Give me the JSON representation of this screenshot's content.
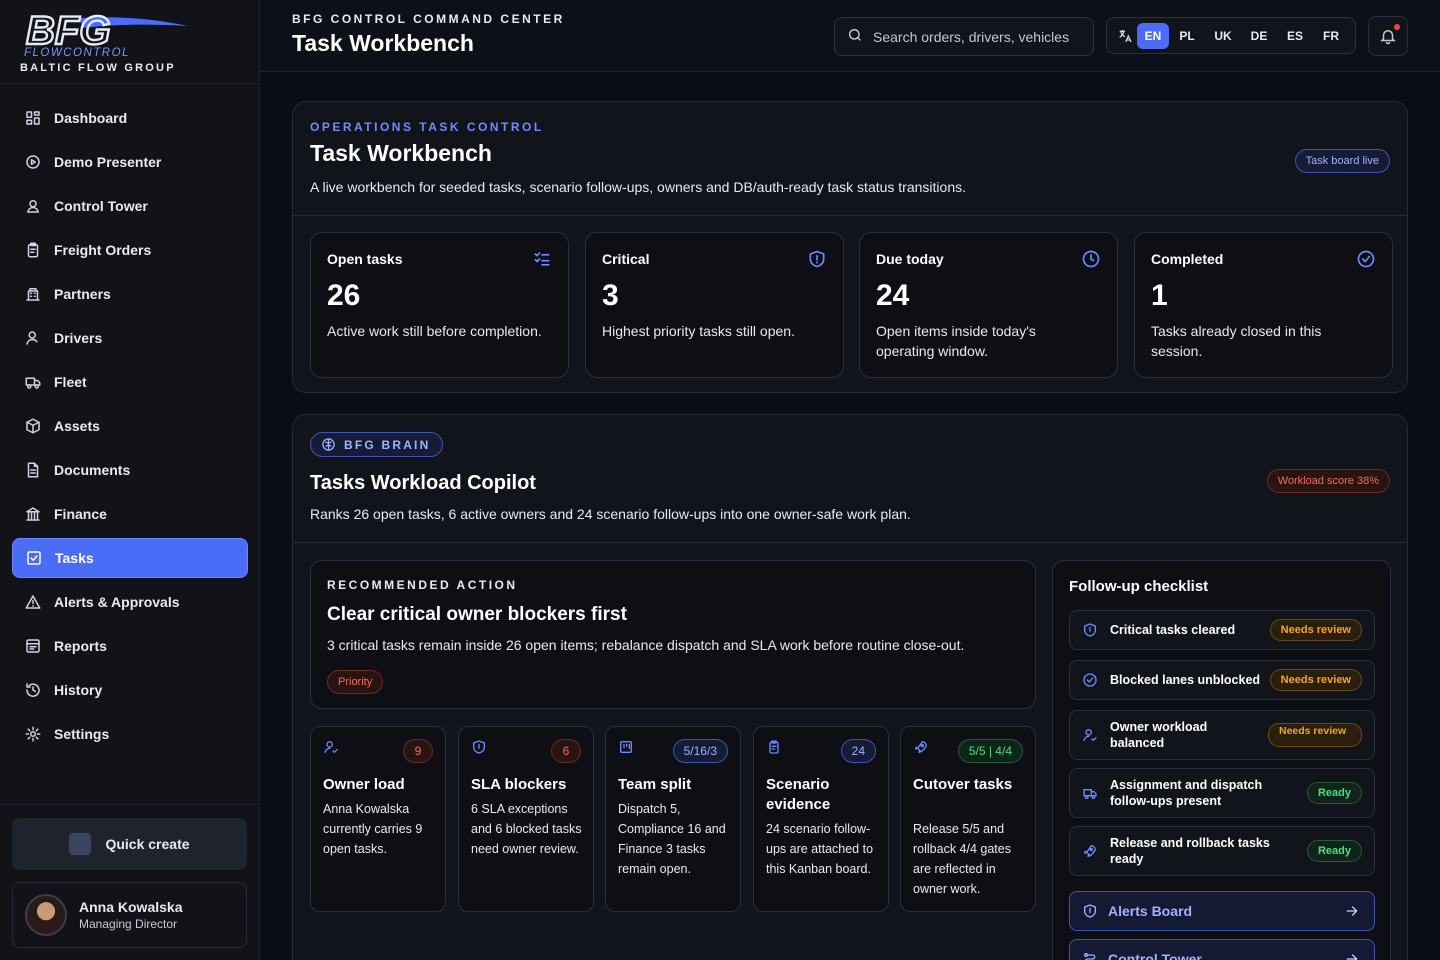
{
  "brand": {
    "logo_text": "BFG",
    "logo_sub": "FLOWCONTROL",
    "subtitle": "BALTIC FLOW GROUP"
  },
  "nav": [
    {
      "label": "Dashboard",
      "icon": "dashboard-icon"
    },
    {
      "label": "Demo Presenter",
      "icon": "play-icon"
    },
    {
      "label": "Control Tower",
      "icon": "control-tower-icon"
    },
    {
      "label": "Freight Orders",
      "icon": "clipboard-icon"
    },
    {
      "label": "Partners",
      "icon": "building-icon"
    },
    {
      "label": "Drivers",
      "icon": "user-icon"
    },
    {
      "label": "Fleet",
      "icon": "truck-icon"
    },
    {
      "label": "Assets",
      "icon": "package-icon"
    },
    {
      "label": "Documents",
      "icon": "document-icon"
    },
    {
      "label": "Finance",
      "icon": "bank-icon"
    },
    {
      "label": "Tasks",
      "icon": "checkbox-icon",
      "active": true
    },
    {
      "label": "Alerts & Approvals",
      "icon": "alert-triangle-icon"
    },
    {
      "label": "Reports",
      "icon": "report-icon"
    },
    {
      "label": "History",
      "icon": "history-icon"
    },
    {
      "label": "Settings",
      "icon": "gear-icon"
    }
  ],
  "quick_create": "Quick create",
  "user": {
    "name": "Anna Kowalska",
    "role": "Managing Director"
  },
  "header": {
    "kicker": "BFG CONTROL COMMAND CENTER",
    "title": "Task Workbench",
    "search_placeholder": "Search orders, drivers, vehicles",
    "languages": [
      "EN",
      "PL",
      "UK",
      "DE",
      "ES",
      "FR"
    ],
    "active_language": "EN"
  },
  "workbench": {
    "kicker": "OPERATIONS TASK CONTROL",
    "title": "Task Workbench",
    "description": "A live workbench for seeded tasks, scenario follow-ups, owners and DB/auth-ready task status transitions.",
    "status_pill": "Task board live",
    "stats": [
      {
        "label": "Open tasks",
        "value": "26",
        "desc": "Active work still before completion.",
        "icon": "list-check-icon"
      },
      {
        "label": "Critical",
        "value": "3",
        "desc": "Highest priority tasks still open.",
        "icon": "shield-alert-icon"
      },
      {
        "label": "Due today",
        "value": "24",
        "desc": "Open items inside today's operating window.",
        "icon": "clock-icon"
      },
      {
        "label": "Completed",
        "value": "1",
        "desc": "Tasks already closed in this session.",
        "icon": "check-circle-icon"
      }
    ]
  },
  "copilot": {
    "chip": "BFG BRAIN",
    "title": "Tasks Workload Copilot",
    "description": "Ranks 26 open tasks, 6 active owners and 24 scenario follow-ups into one owner-safe work plan.",
    "score_pill": "Workload score 38%",
    "recommended": {
      "kicker": "RECOMMENDED ACTION",
      "title": "Clear critical owner blockers first",
      "description": "3 critical tasks remain inside 26 open items; rebalance dispatch and SLA work before routine close-out.",
      "pill": "Priority"
    },
    "cards": [
      {
        "title": "Owner load",
        "badge": "9",
        "badge_tone": "red",
        "desc": "Anna Kowalska currently carries 9 open tasks.",
        "icon": "user-check-icon"
      },
      {
        "title": "SLA blockers",
        "badge": "6",
        "badge_tone": "red",
        "desc": "6 SLA exceptions and 6 blocked tasks need owner review.",
        "icon": "shield-icon"
      },
      {
        "title": "Team split",
        "badge": "5/16/3",
        "badge_tone": "blue",
        "desc": "Dispatch 5, Compliance 16 and Finance 3 tasks remain open.",
        "icon": "columns-icon"
      },
      {
        "title": "Scenario evidence",
        "badge": "24",
        "badge_tone": "blue",
        "desc": "24 scenario follow-ups are attached to this Kanban board.",
        "icon": "clipboard-icon"
      },
      {
        "title": "Cutover tasks",
        "badge": "5/5 | 4/4",
        "badge_tone": "green",
        "desc": "Release 5/5 and rollback 4/4 gates are reflected in owner work.",
        "icon": "rocket-icon"
      }
    ],
    "checklist": {
      "title": "Follow-up checklist",
      "items": [
        {
          "label": "Critical tasks cleared",
          "status": "Needs review",
          "tone": "amber",
          "icon": "shield-icon"
        },
        {
          "label": "Blocked lanes unblocked",
          "status": "Needs review",
          "tone": "amber",
          "icon": "check-circle-icon"
        },
        {
          "label": "Owner workload balanced",
          "status": "Needs review",
          "tone": "amber",
          "icon": "user-check-icon"
        },
        {
          "label": "Assignment and dispatch follow-ups present",
          "status": "Ready",
          "tone": "green",
          "icon": "truck-icon"
        },
        {
          "label": "Release and rollback tasks ready",
          "status": "Ready",
          "tone": "green",
          "icon": "rocket-icon"
        }
      ],
      "links": [
        {
          "label": "Alerts Board",
          "icon": "shield-icon"
        },
        {
          "label": "Control Tower",
          "icon": "route-icon"
        }
      ]
    }
  }
}
